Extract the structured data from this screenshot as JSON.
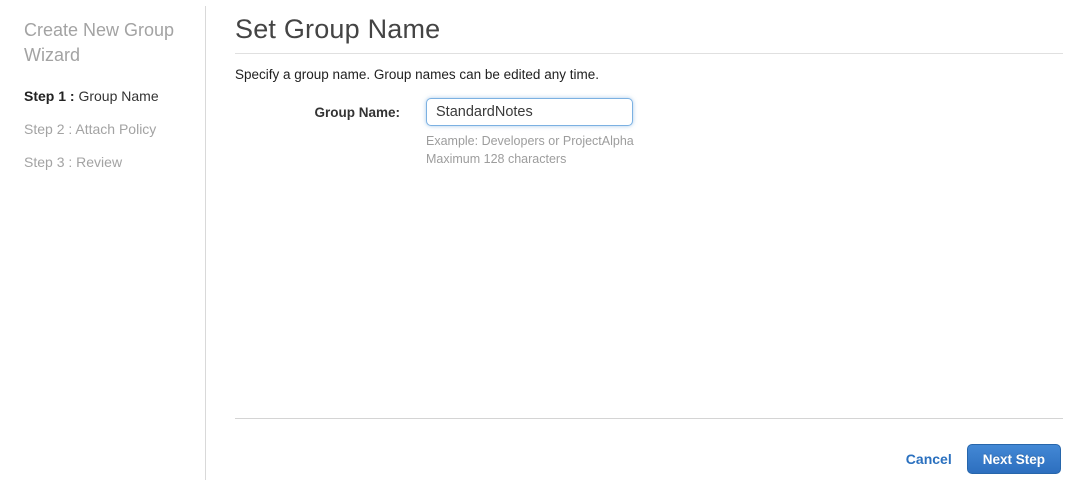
{
  "sidebar": {
    "title": "Create New Group Wizard",
    "steps": [
      {
        "prefix": "Step 1 : ",
        "label": "Group Name",
        "active": true
      },
      {
        "prefix": "Step 2 : ",
        "label": "Attach Policy",
        "active": false
      },
      {
        "prefix": "Step 3 : ",
        "label": "Review",
        "active": false
      }
    ]
  },
  "main": {
    "title": "Set Group Name",
    "description": "Specify a group name. Group names can be edited any time.",
    "form": {
      "group_name_label": "Group Name:",
      "group_name_value": "StandardNotes",
      "hint_example": "Example: Developers or ProjectAlpha",
      "hint_max": "Maximum 128 characters"
    },
    "footer": {
      "cancel_label": "Cancel",
      "next_label": "Next Step"
    }
  },
  "colors": {
    "link_blue": "#2a70bf",
    "button_top": "#4388d5",
    "button_bottom": "#2d6fbf",
    "button_border": "#2766ab",
    "input_focus_border": "#7cb1e2"
  }
}
